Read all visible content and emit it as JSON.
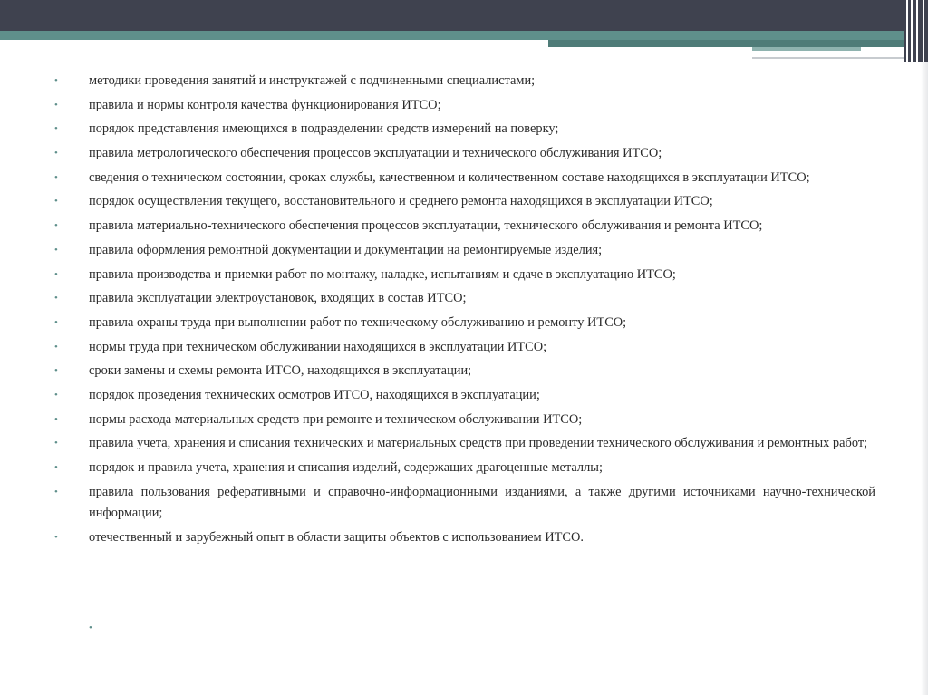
{
  "theme": {
    "accent": "#5f8f8b",
    "header": "#3f424f",
    "text": "#2b2b2b"
  },
  "bullet_glyph": "•",
  "items": [
    "методики проведения занятий и инструктажей с подчиненными специалистами;",
    "правила и нормы контроля качества функционирования ИТСО;",
    "порядок представления имеющихся в подразделении средств измерений на поверку;",
    "правила метрологического обеспечения процессов эксплуатации и технического обслуживания ИТСО;",
    "сведения о техническом состоянии, сроках службы, качественном и количественном составе находящихся в эксплуатации ИТСО;",
    "порядок осуществления текущего, восстановительного и среднего ремонта находящихся в эксплуатации ИТСО;",
    "правила материально-технического обеспечения процессов эксплуатации, технического обслуживания и ремонта ИТСО;",
    "правила оформления ремонтной документации и документации на ремонтируемые изделия;",
    "правила производства и приемки работ по монтажу, наладке, испытаниям и сдаче в эксплуатацию ИТСО;",
    "правила эксплуатации электроустановок, входящих в состав ИТСО;",
    "правила охраны труда при выполнении работ по техническому обслуживанию и ремонту ИТСО;",
    "нормы труда при техническом обслуживании находящихся в эксплуатации ИТСО;",
    "сроки замены и схемы ремонта ИТСО, находящихся в эксплуатации;",
    "порядок проведения технических осмотров ИТСО, находящихся в эксплуатации;",
    "нормы расхода материальных средств при ремонте и техническом обслуживании ИТСО;",
    "правила учета, хранения и списания технических и материальных средств при проведении технического обслуживания и ремонтных работ;",
    "порядок и правила учета, хранения и списания изделий, содержащих драгоценные металлы;",
    "правила пользования реферативными и справочно-информационными изданиями, а также другими источниками научно-технической информации;",
    "отечественный и зарубежный опыт в области защиты объектов с использованием ИТСО."
  ]
}
